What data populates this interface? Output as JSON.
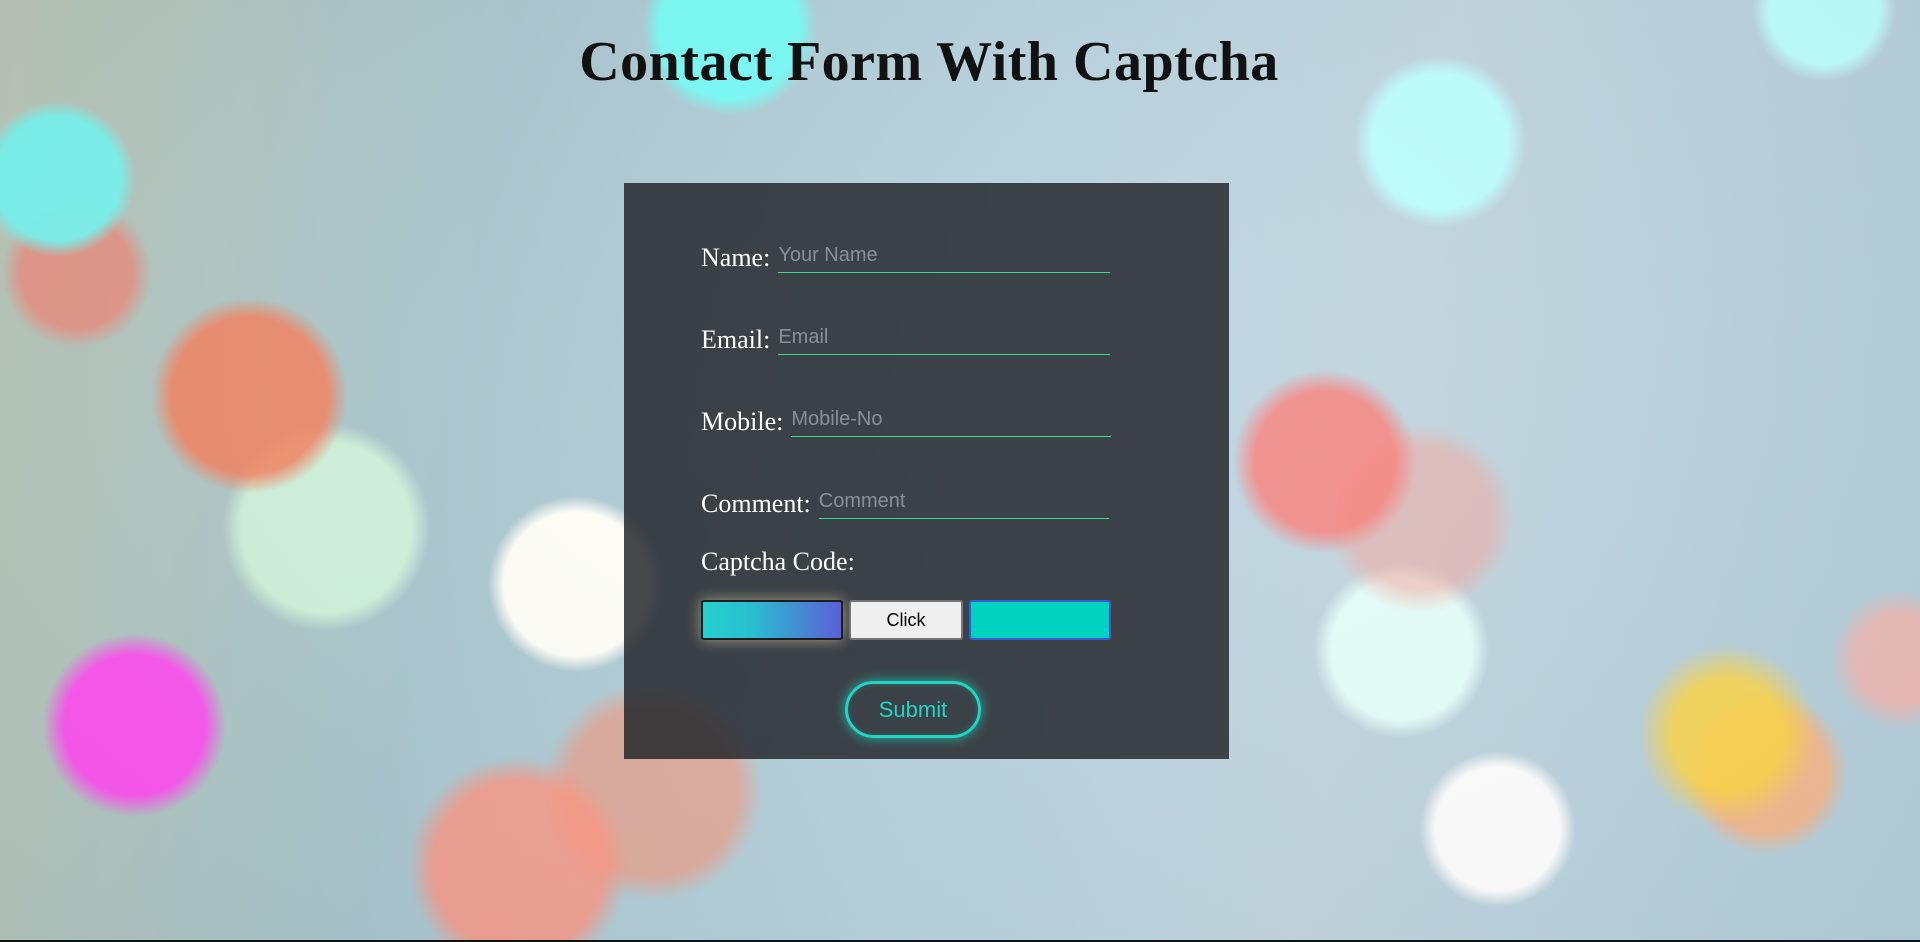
{
  "page": {
    "title": "Contact Form With Captcha"
  },
  "form": {
    "name": {
      "label": "Name:",
      "placeholder": "Your Name",
      "value": ""
    },
    "email": {
      "label": "Email:",
      "placeholder": "Email",
      "value": ""
    },
    "mobile": {
      "label": "Mobile:",
      "placeholder": "Mobile-No",
      "value": ""
    },
    "comment": {
      "label": "Comment:",
      "placeholder": "Comment",
      "value": ""
    },
    "captcha": {
      "label": "Captcha Code:",
      "code": "",
      "button_label": "Click",
      "input_value": ""
    },
    "submit_label": "Submit"
  },
  "colors": {
    "accent": "#1fd6c4",
    "underline": "#3ddc8a",
    "panel": "#262a2e"
  }
}
